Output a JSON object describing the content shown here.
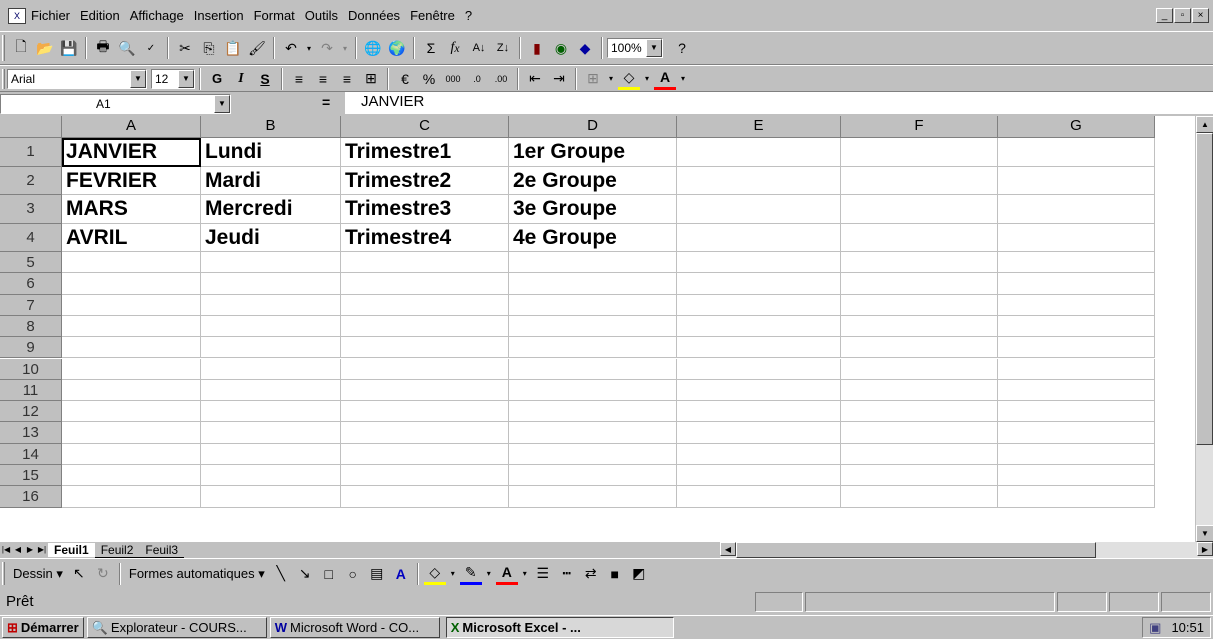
{
  "menubar": {
    "items": [
      "Fichier",
      "Edition",
      "Affichage",
      "Insertion",
      "Format",
      "Outils",
      "Données",
      "Fenêtre",
      "?"
    ]
  },
  "toolbar1": {
    "zoom": "100%"
  },
  "toolbar2": {
    "font": "Arial",
    "size": "12",
    "bold": "G",
    "italic": "I",
    "underline": "S"
  },
  "formula_bar": {
    "name_box": "A1",
    "equals": "=",
    "content": "JANVIER"
  },
  "columns": [
    "A",
    "B",
    "C",
    "D",
    "E",
    "F",
    "G"
  ],
  "rows": [
    "1",
    "2",
    "3",
    "4",
    "5",
    "6",
    "7",
    "8",
    "9",
    "10",
    "11",
    "12",
    "13",
    "14",
    "15",
    "16"
  ],
  "cells": [
    [
      "JANVIER",
      "Lundi",
      "Trimestre1",
      "1er Groupe"
    ],
    [
      "FEVRIER",
      "Mardi",
      "Trimestre2",
      "2e Groupe"
    ],
    [
      "MARS",
      "Mercredi",
      "Trimestre3",
      "3e Groupe"
    ],
    [
      "AVRIL",
      "Jeudi",
      "Trimestre4",
      "4e Groupe"
    ]
  ],
  "sheet_tabs": [
    "Feuil1",
    "Feuil2",
    "Feuil3"
  ],
  "drawbar": {
    "dessin": "Dessin",
    "formes": "Formes automatiques"
  },
  "status": "Prêt",
  "taskbar": {
    "start": "Démarrer",
    "tasks": [
      "Explorateur - COURS...",
      "Microsoft Word - CO...",
      "Microsoft Excel - ..."
    ],
    "clock": "10:51"
  }
}
